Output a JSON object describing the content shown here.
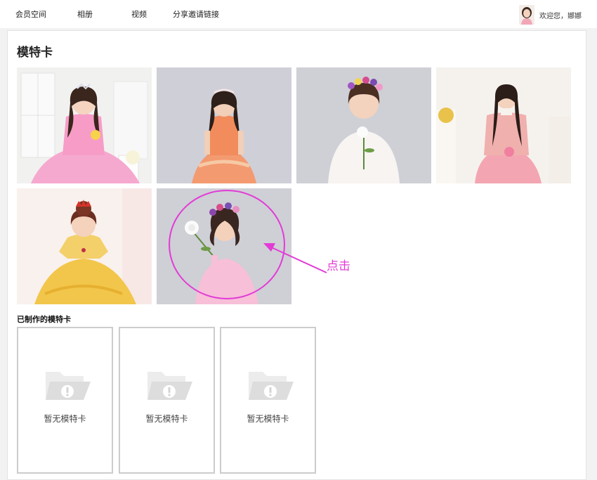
{
  "nav": {
    "items": [
      {
        "label": "会员空间"
      },
      {
        "label": "相册"
      },
      {
        "label": "视频"
      },
      {
        "label": "分享邀请链接"
      }
    ]
  },
  "user": {
    "welcome": "欢迎您，娜娜"
  },
  "main": {
    "title": "模特卡",
    "made_section_title": "已制作的模特卡",
    "empty_label": "暂无模特卡",
    "photos": [
      {
        "icon": "girl-pink-gown-photo"
      },
      {
        "icon": "girl-orange-dress-photo"
      },
      {
        "icon": "girl-white-lace-photo"
      },
      {
        "icon": "girl-floral-dress-photo"
      },
      {
        "icon": "girl-yellow-gown-photo"
      },
      {
        "icon": "girl-pink-holding-rose-photo"
      }
    ],
    "empty_cards": [
      {
        "label": "暂无模特卡"
      },
      {
        "label": "暂无模特卡"
      },
      {
        "label": "暂无模特卡"
      }
    ]
  },
  "annotation": {
    "text": "点击",
    "color": "#e23bd6"
  }
}
